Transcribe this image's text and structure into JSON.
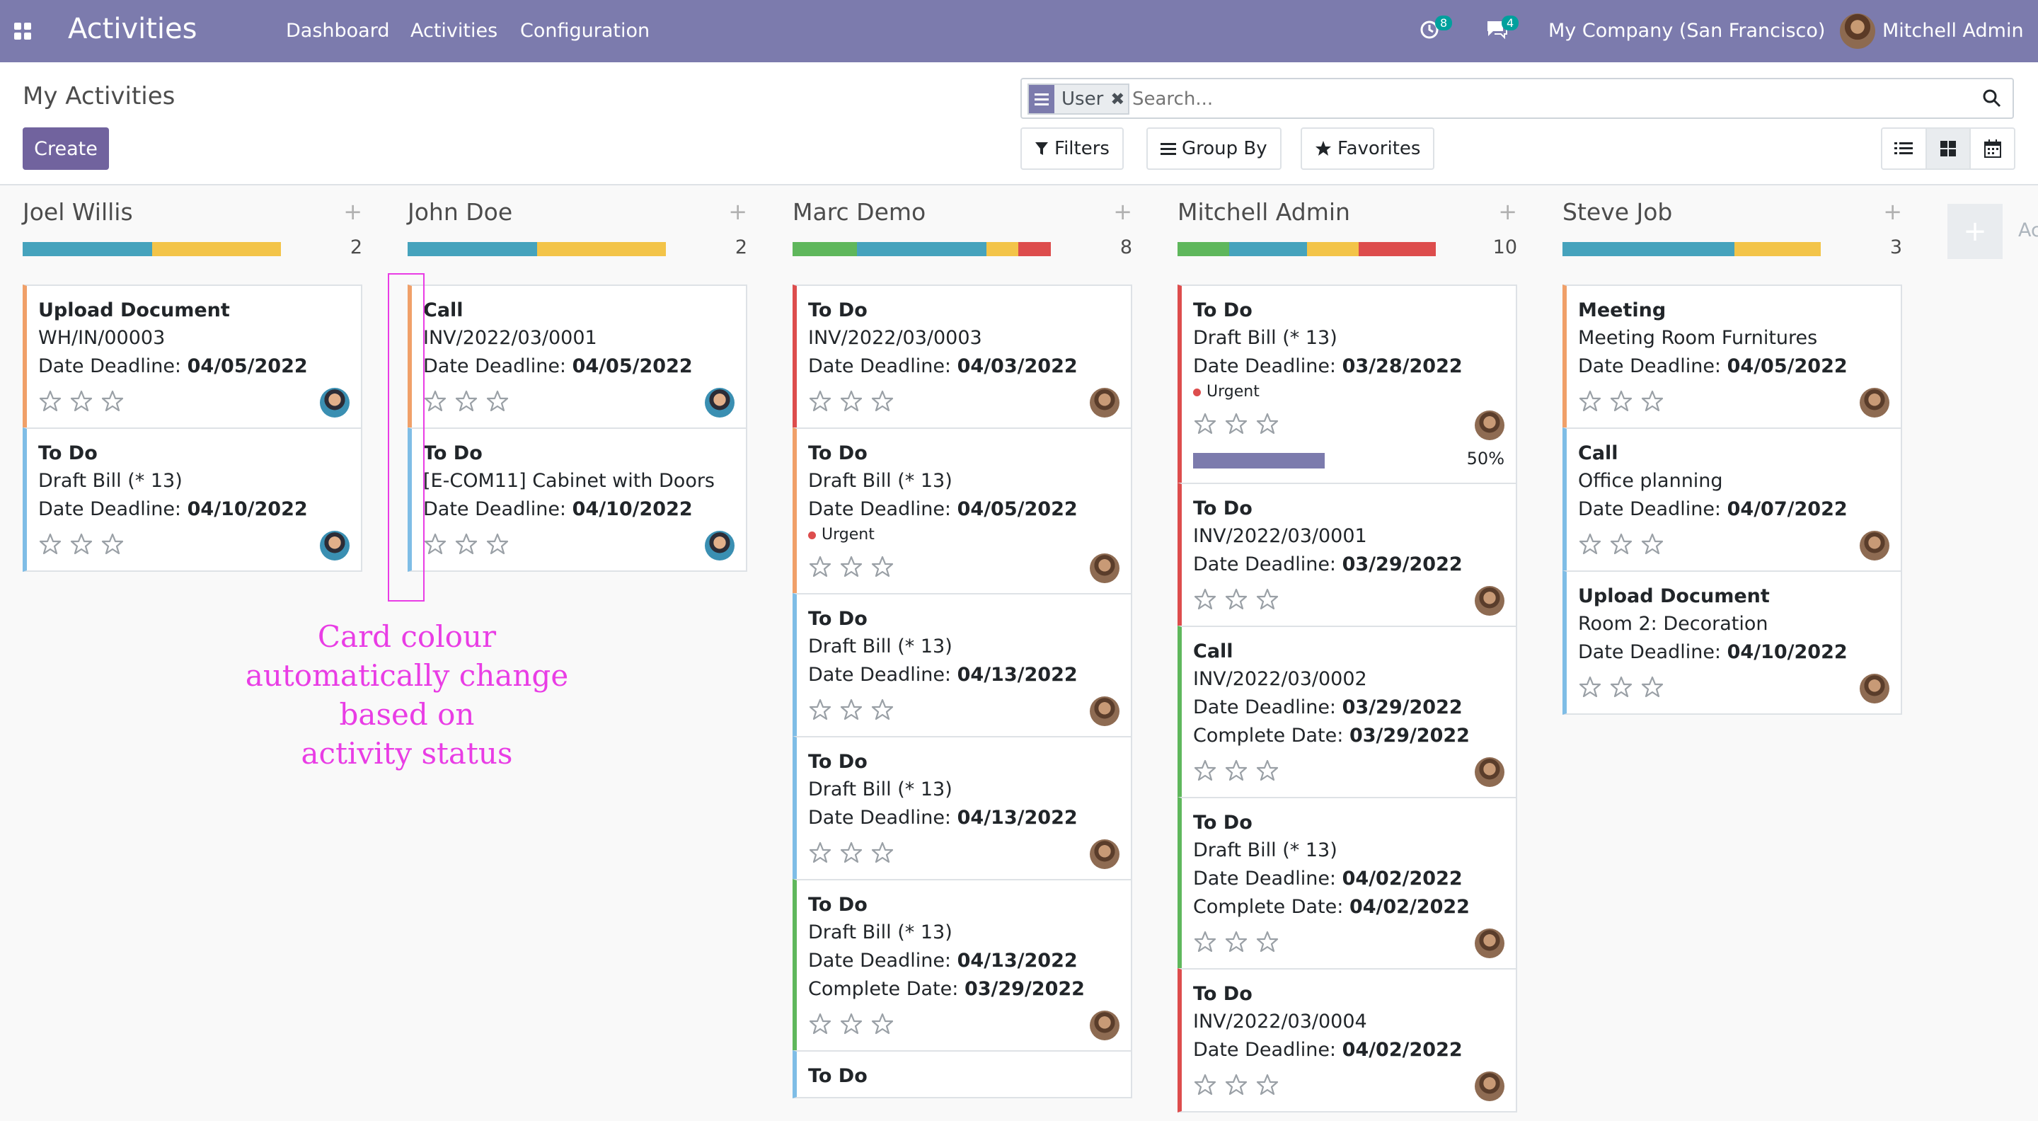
{
  "navbar": {
    "brand": "Activities",
    "menu": [
      "Dashboard",
      "Activities",
      "Configuration"
    ],
    "activity_count": "8",
    "message_count": "4",
    "company": "My Company (San Francisco)",
    "user": "Mitchell Admin",
    "color": "#7c7bad"
  },
  "control_panel": {
    "breadcrumb": "My Activities",
    "create_label": "Create",
    "facet_label": "User",
    "search_placeholder": "Search...",
    "filters_label": "Filters",
    "groupby_label": "Group By",
    "favorites_label": "Favorites"
  },
  "status_colors": {
    "green": "#5fb75c",
    "blue": "#46a3bd",
    "yellow": "#f3c449",
    "red": "#dd4d4d"
  },
  "columns": [
    {
      "name": "Joel Willis",
      "count": "2",
      "progress": [
        {
          "status": "blue",
          "fraction": 0.5
        },
        {
          "status": "yellow",
          "fraction": 0.5
        }
      ],
      "cards": [
        {
          "title": "Upload Document",
          "ref": "WH/IN/00003",
          "deadline_label": "Date Deadline:",
          "deadline": "04/05/2022",
          "color": "orange",
          "avatar": "a1"
        },
        {
          "title": "To Do",
          "ref": "Draft Bill (* 13)",
          "deadline_label": "Date Deadline:",
          "deadline": "04/10/2022",
          "color": "blue",
          "avatar": "a1"
        }
      ]
    },
    {
      "name": "John Doe",
      "count": "2",
      "progress": [
        {
          "status": "blue",
          "fraction": 0.5
        },
        {
          "status": "yellow",
          "fraction": 0.5
        }
      ],
      "cards": [
        {
          "title": "Call",
          "ref": "INV/2022/03/0001",
          "deadline_label": "Date Deadline:",
          "deadline": "04/05/2022",
          "color": "orange",
          "avatar": "a1"
        },
        {
          "title": "To Do",
          "ref": "[E-COM11] Cabinet with Doors",
          "deadline_label": "Date Deadline:",
          "deadline": "04/10/2022",
          "color": "blue",
          "avatar": "a1"
        }
      ]
    },
    {
      "name": "Marc Demo",
      "count": "8",
      "progress": [
        {
          "status": "green",
          "fraction": 0.25
        },
        {
          "status": "blue",
          "fraction": 0.5
        },
        {
          "status": "yellow",
          "fraction": 0.125
        },
        {
          "status": "red",
          "fraction": 0.125
        }
      ],
      "cards": [
        {
          "title": "To Do",
          "ref": "INV/2022/03/0003",
          "deadline_label": "Date Deadline:",
          "deadline": "04/03/2022",
          "color": "red",
          "avatar": "a2"
        },
        {
          "title": "To Do",
          "ref": "Draft Bill (* 13)",
          "deadline_label": "Date Deadline:",
          "deadline": "04/05/2022",
          "tag": "Urgent",
          "color": "orange",
          "avatar": "a2"
        },
        {
          "title": "To Do",
          "ref": "Draft Bill (* 13)",
          "deadline_label": "Date Deadline:",
          "deadline": "04/13/2022",
          "color": "blue",
          "avatar": "a2"
        },
        {
          "title": "To Do",
          "ref": "Draft Bill (* 13)",
          "deadline_label": "Date Deadline:",
          "deadline": "04/13/2022",
          "color": "blue",
          "avatar": "a2"
        },
        {
          "title": "To Do",
          "ref": "Draft Bill (* 13)",
          "deadline_label": "Date Deadline:",
          "deadline": "04/13/2022",
          "complete_label": "Complete Date:",
          "complete": "03/29/2022",
          "color": "green",
          "avatar": "a2"
        },
        {
          "title": "To Do",
          "color": "blue",
          "partial": true
        }
      ]
    },
    {
      "name": "Mitchell Admin",
      "count": "10",
      "progress": [
        {
          "status": "green",
          "fraction": 0.2
        },
        {
          "status": "blue",
          "fraction": 0.3
        },
        {
          "status": "yellow",
          "fraction": 0.2
        },
        {
          "status": "red",
          "fraction": 0.3
        }
      ],
      "cards": [
        {
          "title": "To Do",
          "ref": "Draft Bill (* 13)",
          "deadline_label": "Date Deadline:",
          "deadline": "03/28/2022",
          "tag": "Urgent",
          "progress_label": "50%",
          "progress": 0.5,
          "color": "red",
          "avatar": "a2"
        },
        {
          "title": "To Do",
          "ref": "INV/2022/03/0001",
          "deadline_label": "Date Deadline:",
          "deadline": "03/29/2022",
          "color": "red",
          "avatar": "a2"
        },
        {
          "title": "Call",
          "ref": "INV/2022/03/0002",
          "deadline_label": "Date Deadline:",
          "deadline": "03/29/2022",
          "complete_label": "Complete Date:",
          "complete": "03/29/2022",
          "color": "green",
          "avatar": "a2"
        },
        {
          "title": "To Do",
          "ref": "Draft Bill (* 13)",
          "deadline_label": "Date Deadline:",
          "deadline": "04/02/2022",
          "complete_label": "Complete Date:",
          "complete": "04/02/2022",
          "color": "green",
          "avatar": "a2"
        },
        {
          "title": "To Do",
          "ref": "INV/2022/03/0004",
          "deadline_label": "Date Deadline:",
          "deadline": "04/02/2022",
          "color": "red",
          "avatar": "a2"
        }
      ]
    },
    {
      "name": "Steve Job",
      "count": "3",
      "progress": [
        {
          "status": "blue",
          "fraction": 0.667
        },
        {
          "status": "yellow",
          "fraction": 0.333
        }
      ],
      "cards": [
        {
          "title": "Meeting",
          "ref": "Meeting Room Furnitures",
          "deadline_label": "Date Deadline:",
          "deadline": "04/05/2022",
          "color": "orange",
          "avatar": "a2"
        },
        {
          "title": "Call",
          "ref": "Office planning",
          "deadline_label": "Date Deadline:",
          "deadline": "04/07/2022",
          "color": "blue",
          "avatar": "a2"
        },
        {
          "title": "Upload Document",
          "ref": "Room 2: Decoration",
          "deadline_label": "Date Deadline:",
          "deadline": "04/10/2022",
          "color": "blue",
          "avatar": "a2"
        }
      ]
    }
  ],
  "add_column_label": "Ac",
  "annotation": {
    "lines": [
      "Card colour",
      "automatically change",
      "based on",
      "activity status"
    ],
    "color": "#e93de5"
  }
}
